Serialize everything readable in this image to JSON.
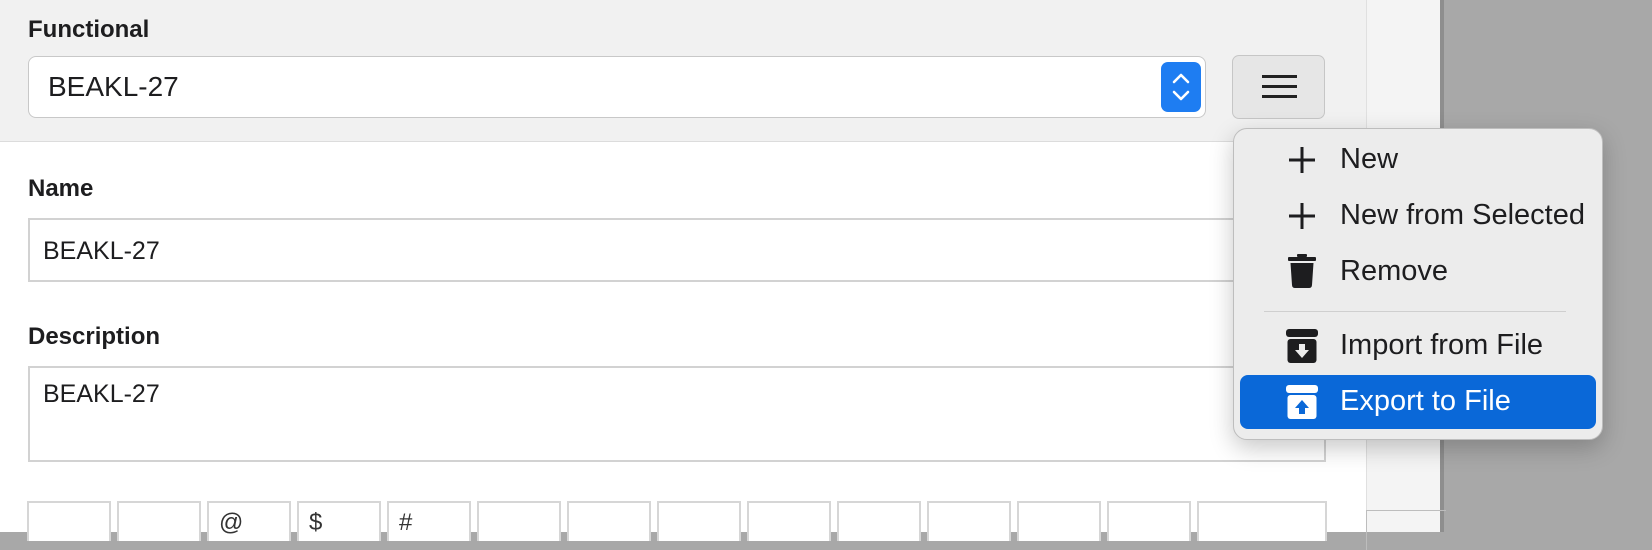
{
  "functional": {
    "label": "Functional",
    "selected_value": "BEAKL-27"
  },
  "name": {
    "label": "Name",
    "value": "BEAKL-27"
  },
  "description": {
    "label": "Description",
    "value": "BEAKL-27"
  },
  "key_row": [
    "",
    "",
    "@",
    "$",
    "#",
    "",
    "",
    "",
    "",
    "",
    "",
    "",
    "",
    ""
  ],
  "menu": {
    "items": [
      {
        "label": "New",
        "icon": "plus-icon"
      },
      {
        "label": "New from Selected",
        "icon": "plus-icon"
      },
      {
        "label": "Remove",
        "icon": "trash-icon"
      },
      {
        "label": "Import from File",
        "icon": "import-box-icon"
      },
      {
        "label": "Export to File",
        "icon": "export-box-icon",
        "selected": true
      }
    ]
  },
  "colors": {
    "accent": "#0a68d8",
    "stepper": "#1e7df2"
  }
}
